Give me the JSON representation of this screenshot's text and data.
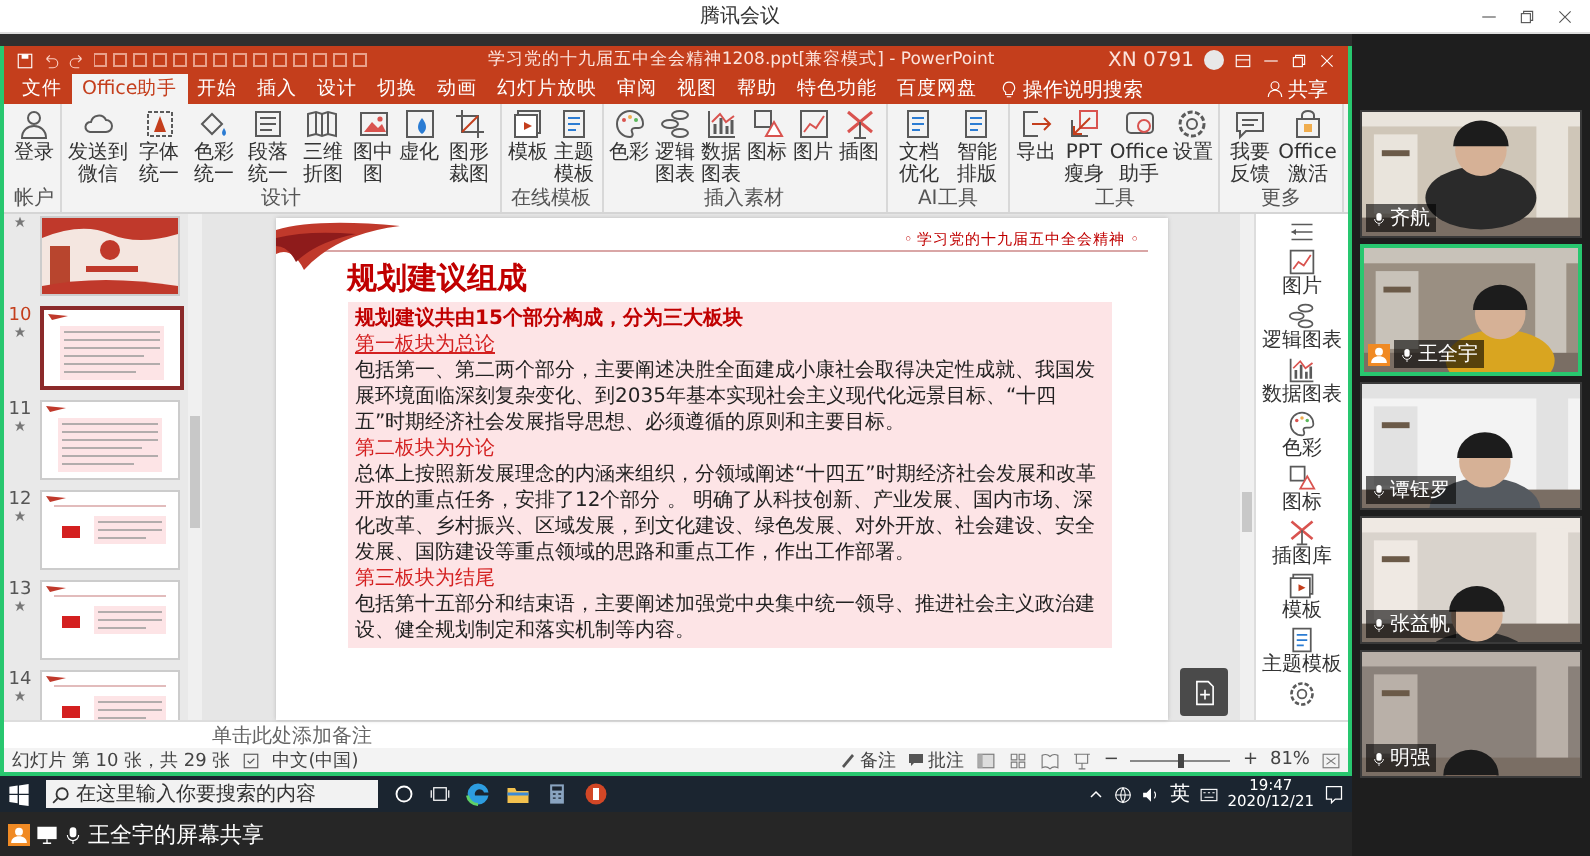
{
  "meeting": {
    "title": "腾讯会议"
  },
  "powerpoint": {
    "title": "学习党的十九届五中全会精神1208.ppt[兼容模式] - PowerPoint",
    "user": "XN 0791",
    "share": "共享",
    "search": "操作说明搜索",
    "tabs": [
      {
        "label": "文件",
        "selected": false
      },
      {
        "label": "Office助手",
        "selected": true
      },
      {
        "label": "开始",
        "selected": false
      },
      {
        "label": "插入",
        "selected": false
      },
      {
        "label": "设计",
        "selected": false
      },
      {
        "label": "切换",
        "selected": false
      },
      {
        "label": "动画",
        "selected": false
      },
      {
        "label": "幻灯片放映",
        "selected": false
      },
      {
        "label": "审阅",
        "selected": false
      },
      {
        "label": "视图",
        "selected": false
      },
      {
        "label": "帮助",
        "selected": false
      },
      {
        "label": "特色功能",
        "selected": false
      },
      {
        "label": "百度网盘",
        "selected": false
      }
    ],
    "ribbon": [
      {
        "group": "帐户",
        "buttons": [
          "登录"
        ]
      },
      {
        "group": "设计",
        "buttons": [
          "发送到微信",
          "字体统一",
          "色彩统一",
          "段落统一",
          "三维折图",
          "图中图",
          "虚化",
          "图形裁图"
        ]
      },
      {
        "group": "在线模板",
        "buttons": [
          "模板",
          "主题模板"
        ]
      },
      {
        "group": "插入素材",
        "buttons": [
          "色彩",
          "逻辑图表",
          "数据图表",
          "图标",
          "图片",
          "插图"
        ]
      },
      {
        "group": "AI工具",
        "buttons": [
          "文档优化",
          "智能排版"
        ]
      },
      {
        "group": "工具",
        "buttons": [
          "导出",
          "PPT瘦身",
          "Office助手",
          "设置"
        ]
      },
      {
        "group": "更多",
        "buttons": [
          "我要反馈",
          "Office激活"
        ]
      }
    ]
  },
  "thumbnails": [
    {
      "kind": "cover",
      "selected": false
    },
    {
      "number": "10",
      "kind": "text",
      "selected": true
    },
    {
      "number": "11",
      "kind": "text",
      "selected": false
    },
    {
      "number": "12",
      "kind": "flag",
      "selected": false
    },
    {
      "number": "13",
      "kind": "flag",
      "selected": false
    },
    {
      "number": "14",
      "kind": "flag",
      "selected": false
    }
  ],
  "slide": {
    "header": "◦ 学习党的十九届五中全会精神 ◦",
    "title": "规划建议组成",
    "subtitle": "规划建议共由15个部分构成，分为三大板块",
    "sections": [
      {
        "heading": "第一板块为总论",
        "underlined": true,
        "body": "包括第一、第二两个部分，主要阐述决胜全面建成小康社会取得决定性成就、我国发展环境面临深刻复杂变化、到2035年基本实现社会主义现代化远景目标、“十四五”时期经济社会发展指导思想、必须遵循的原则和主要目标。"
      },
      {
        "heading": "第二板块为分论",
        "underlined": false,
        "body": "总体上按照新发展理念的内涵来组织，分领域阐述“十四五”时期经济社会发展和改革开放的重点任务，安排了12个部分 。 明确了从科技创新、产业发展、国内市场、深化改革、乡村振兴、区域发展，到文化建设、绿色发展、对外开放、社会建设、安全发展、国防建设等重点领域的思路和重点工作，作出工作部署。"
      },
      {
        "heading": "第三板块为结尾",
        "underlined": false,
        "body": "包括第十五部分和结束语，主要阐述加强党中央集中统一领导、推进社会主义政治建设、健全规划制定和落实机制等内容。"
      }
    ]
  },
  "side_panel": [
    "图片",
    "逻辑图表",
    "数据图表",
    "色彩",
    "图标",
    "插图库",
    "模板",
    "主题模板"
  ],
  "notes": {
    "placeholder": "单击此处添加备注"
  },
  "status": {
    "slide_info": "幻灯片 第 10 张，共 29 张",
    "language": "中文(中国)",
    "notes": "备注",
    "comments": "批注",
    "zoom_out": "−",
    "zoom_in": "+",
    "level": 0.5,
    "zoom": "81%"
  },
  "taskbar": {
    "search_placeholder": "在这里输入你要搜索的内容",
    "ime": "英",
    "time": "19:47",
    "date": "2020/12/21"
  },
  "share_bar": {
    "label": "王全宇的屏幕共享"
  },
  "participants": [
    {
      "name": "齐航",
      "speaking": false,
      "host": false
    },
    {
      "name": "王全宇",
      "speaking": true,
      "host": true
    },
    {
      "name": "谭钰罗",
      "speaking": false,
      "host": false
    },
    {
      "name": "张益帆",
      "speaking": false,
      "host": false
    },
    {
      "name": "明强",
      "speaking": false,
      "host": false
    }
  ]
}
